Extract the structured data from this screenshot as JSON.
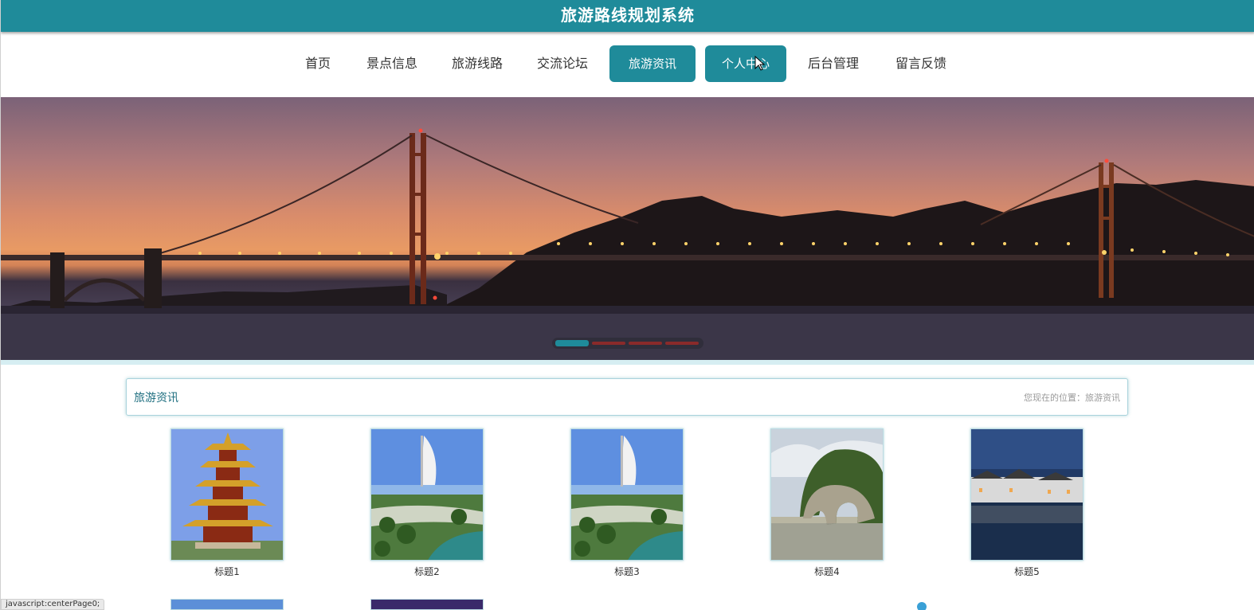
{
  "header": {
    "title": "旅游路线规划系统"
  },
  "nav": {
    "items": [
      {
        "label": "首页",
        "active": false
      },
      {
        "label": "景点信息",
        "active": false
      },
      {
        "label": "旅游线路",
        "active": false
      },
      {
        "label": "交流论坛",
        "active": false
      },
      {
        "label": "旅游资讯",
        "active": true
      },
      {
        "label": "个人中心",
        "active": true
      },
      {
        "label": "后台管理",
        "active": false
      },
      {
        "label": "留言反馈",
        "active": false
      }
    ]
  },
  "banner": {
    "slides": 4,
    "current": 1
  },
  "section": {
    "title": "旅游资讯",
    "breadcrumb": "您现在的位置：旅游资讯"
  },
  "cards": [
    {
      "caption": "标题1",
      "image": "pagoda"
    },
    {
      "caption": "标题2",
      "image": "burj-al-arab"
    },
    {
      "caption": "标题3",
      "image": "burj-al-arab"
    },
    {
      "caption": "标题4",
      "image": "elephant-trunk-hill"
    },
    {
      "caption": "标题5",
      "image": "village-reflection"
    }
  ],
  "status_bar": "javascript:centerPage0;",
  "colors": {
    "primary": "#1f8b9a"
  }
}
